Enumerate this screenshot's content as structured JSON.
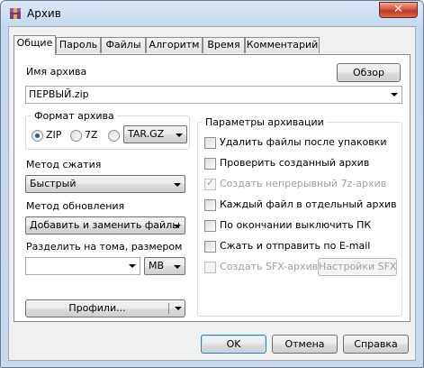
{
  "window": {
    "title": "Архив",
    "close_glyph": "✕"
  },
  "tabs": [
    {
      "label": "Общие",
      "active": true
    },
    {
      "label": "Пароль",
      "active": false
    },
    {
      "label": "Файлы",
      "active": false
    },
    {
      "label": "Алгоритм",
      "active": false
    },
    {
      "label": "Время",
      "active": false
    },
    {
      "label": "Комментарий",
      "active": false
    }
  ],
  "archive_name": {
    "label": "Имя архива",
    "browse_button": "Обзор",
    "value": "ПЕРВЫЙ.zip"
  },
  "format": {
    "title": "Формат архива",
    "options": [
      "ZIP",
      "7Z",
      "TAR.GZ"
    ],
    "selected": "ZIP"
  },
  "compression": {
    "label": "Метод сжатия",
    "value": "Быстрый"
  },
  "update": {
    "label": "Метод обновления",
    "value": "Добавить и заменить файлы"
  },
  "split": {
    "label": "Разделить на тома, размером",
    "size_value": "",
    "unit": "MB"
  },
  "profiles_button": "Профили...",
  "params": {
    "title": "Параметры архивации",
    "options": [
      {
        "label": "Удалить файлы после упаковки",
        "checked": false,
        "enabled": true
      },
      {
        "label": "Проверить созданный архив",
        "checked": false,
        "enabled": true
      },
      {
        "label": "Создать непрерывный 7z-архив",
        "checked": true,
        "enabled": false
      },
      {
        "label": "Каждый файл в отдельный архив",
        "checked": false,
        "enabled": true
      },
      {
        "label": "По окончании выключить ПК",
        "checked": false,
        "enabled": true
      },
      {
        "label": "Сжать и отправить по E-mail",
        "checked": false,
        "enabled": true
      },
      {
        "label": "Создать SFX-архив",
        "checked": false,
        "enabled": false
      }
    ],
    "sfx_settings_button": "Настройки SFX"
  },
  "footer": {
    "ok": "OK",
    "cancel": "Отмена",
    "help": "Справка"
  },
  "colors": {
    "title_gradient": "#c9daef",
    "close_red": "#c0391f",
    "radio_dot": "#2a5b9a"
  }
}
